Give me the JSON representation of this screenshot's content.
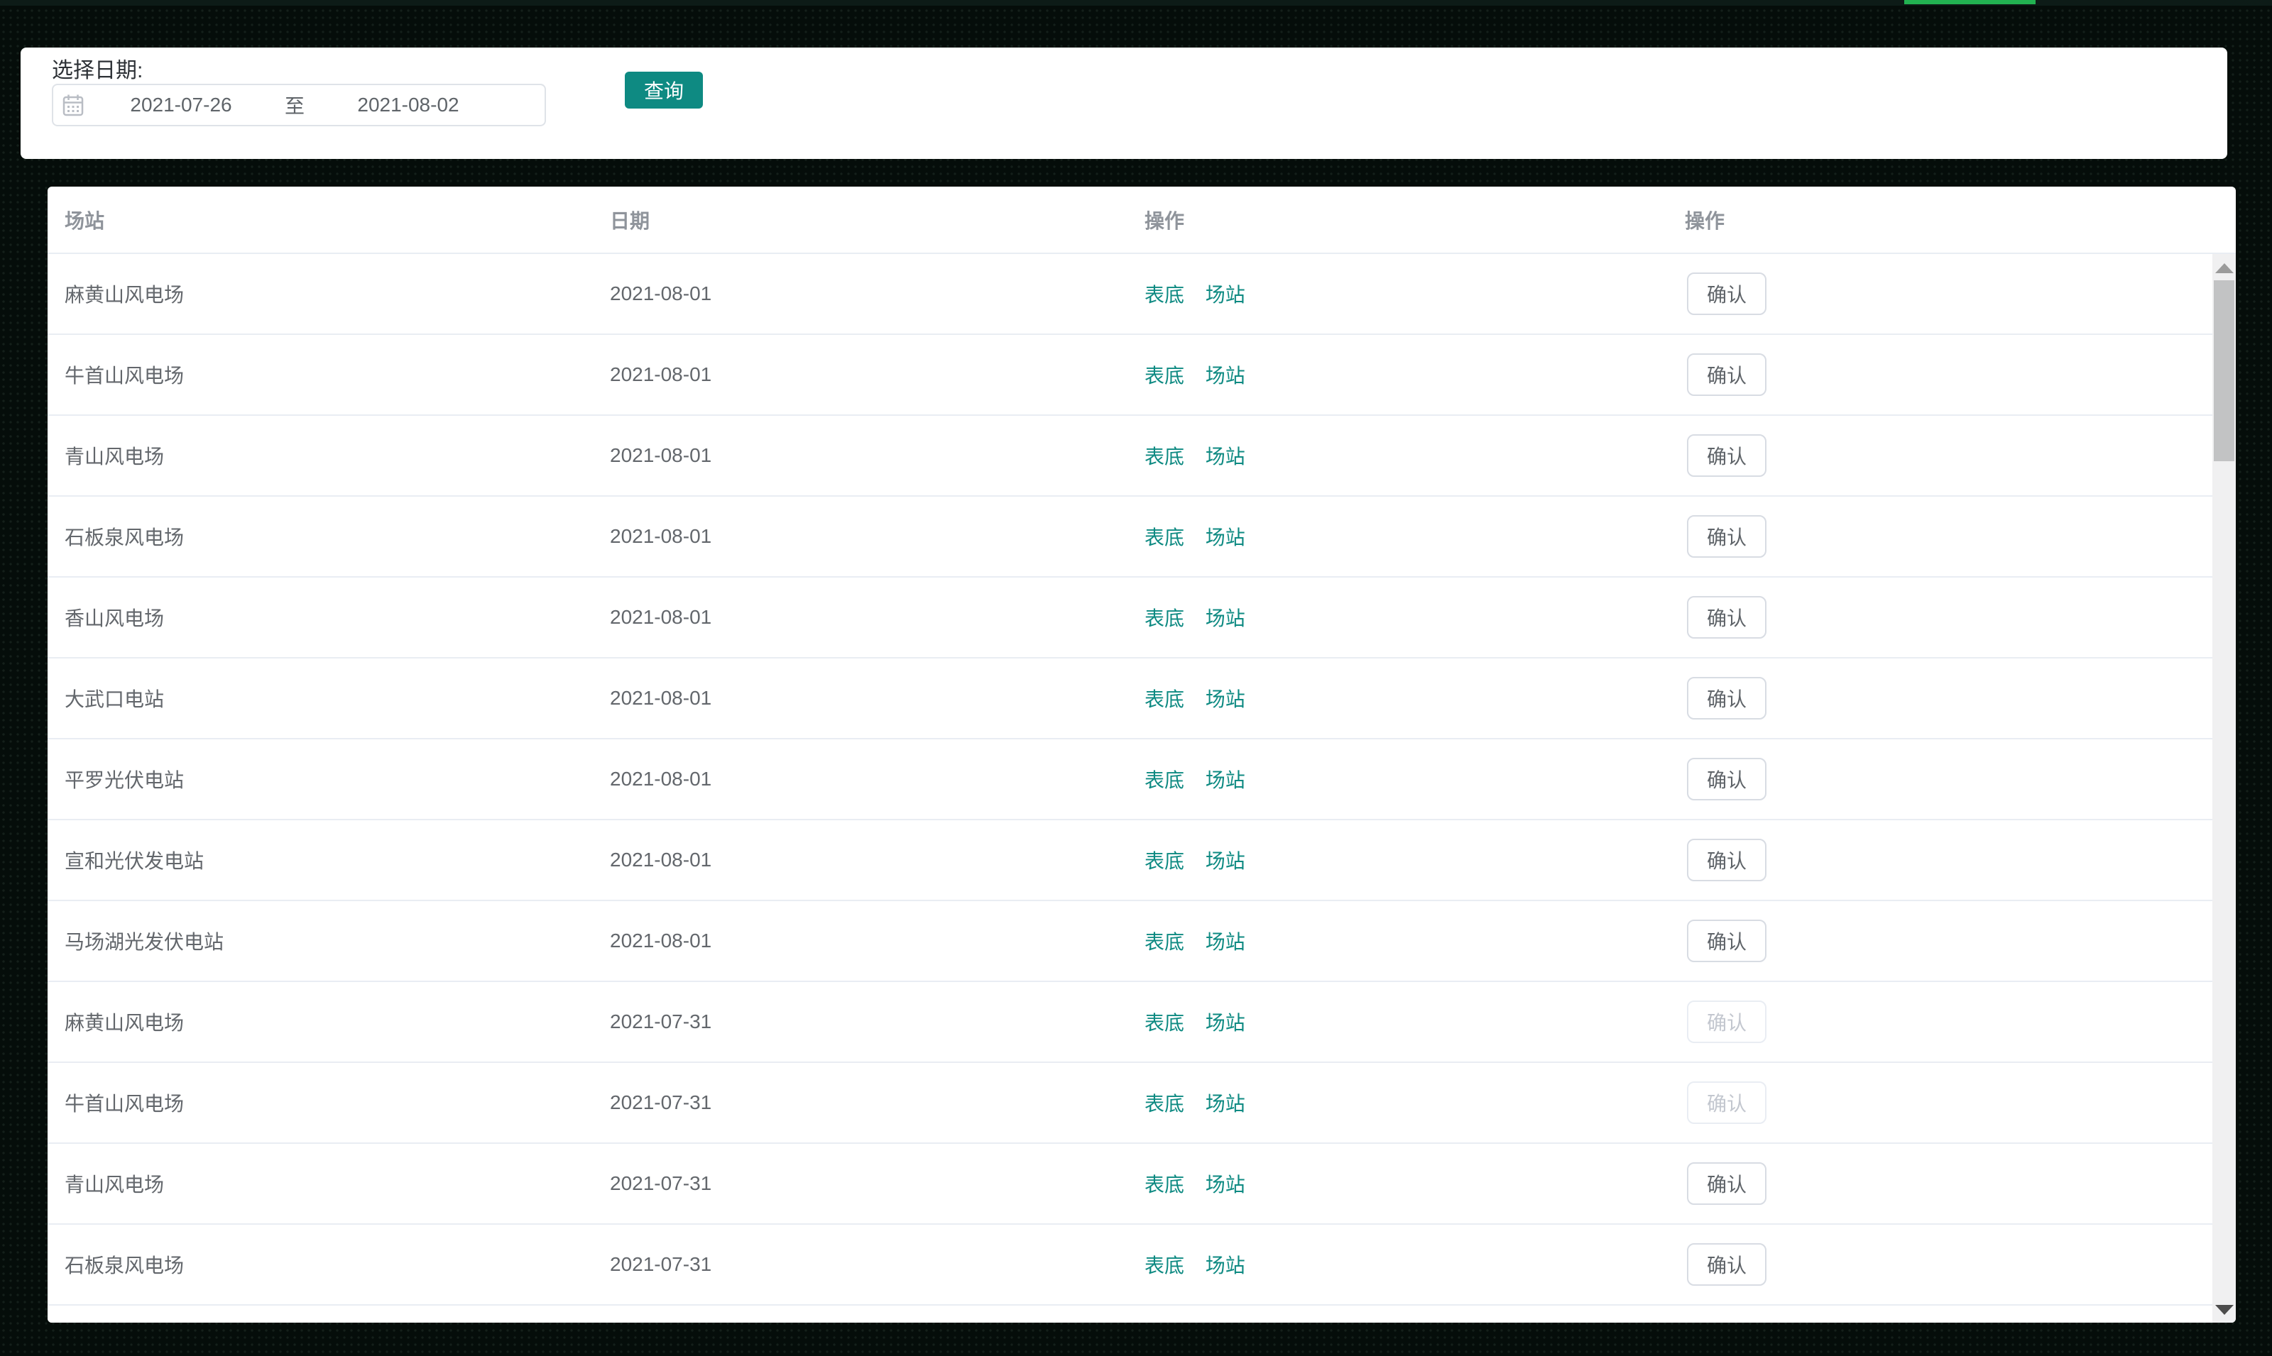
{
  "page": {
    "background_color": "#050d0a",
    "top_accent_color": "#22b151"
  },
  "filter_panel": {
    "date_label": "选择日期:",
    "date_start": "2021-07-26",
    "date_separator": "至",
    "date_end": "2021-08-02",
    "query_button_label": "查询",
    "accent_color": "#0e8a82"
  },
  "table": {
    "columns": [
      "场站",
      "日期",
      "操作",
      "操作"
    ],
    "link_labels": [
      "表底",
      "场站"
    ],
    "confirm_label": "确认",
    "link_color": "#0e8a82",
    "rows": [
      {
        "station": "麻黄山风电场",
        "date": "2021-08-01",
        "confirm_enabled": true
      },
      {
        "station": "牛首山风电场",
        "date": "2021-08-01",
        "confirm_enabled": true
      },
      {
        "station": "青山风电场",
        "date": "2021-08-01",
        "confirm_enabled": true
      },
      {
        "station": "石板泉风电场",
        "date": "2021-08-01",
        "confirm_enabled": true
      },
      {
        "station": "香山风电场",
        "date": "2021-08-01",
        "confirm_enabled": true
      },
      {
        "station": "大武口电站",
        "date": "2021-08-01",
        "confirm_enabled": true
      },
      {
        "station": "平罗光伏电站",
        "date": "2021-08-01",
        "confirm_enabled": true
      },
      {
        "station": "宣和光伏发电站",
        "date": "2021-08-01",
        "confirm_enabled": true
      },
      {
        "station": "马场湖光发伏电站",
        "date": "2021-08-01",
        "confirm_enabled": true
      },
      {
        "station": "麻黄山风电场",
        "date": "2021-07-31",
        "confirm_enabled": false
      },
      {
        "station": "牛首山风电场",
        "date": "2021-07-31",
        "confirm_enabled": false
      },
      {
        "station": "青山风电场",
        "date": "2021-07-31",
        "confirm_enabled": true
      },
      {
        "station": "石板泉风电场",
        "date": "2021-07-31",
        "confirm_enabled": true
      }
    ]
  }
}
